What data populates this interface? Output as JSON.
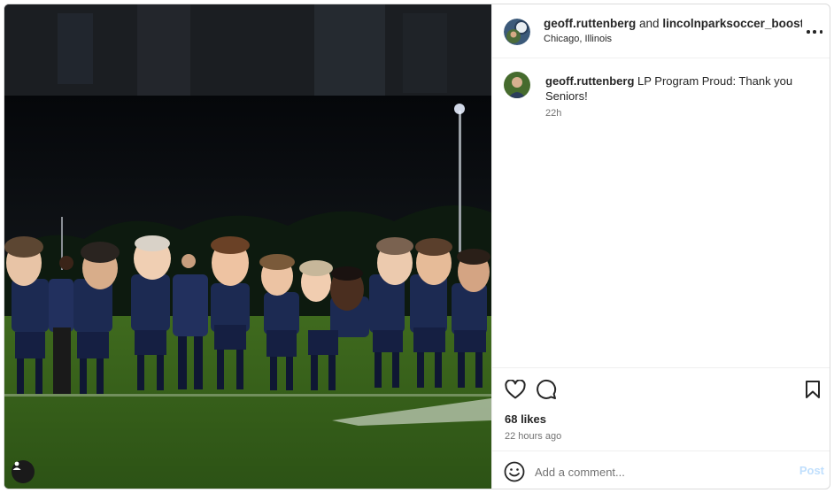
{
  "post": {
    "header": {
      "author": "geoff.ruttenberg",
      "conjunction": "and",
      "collaborator": "lincolnparksoccer_booste",
      "location": "Chicago, Illinois"
    },
    "caption": {
      "username": "geoff.ruttenberg",
      "text": "LP Program Proud: Thank you Seniors!",
      "time": "22h"
    },
    "likes": "68 likes",
    "posted_ago": "22 hours ago",
    "comment": {
      "placeholder": "Add a comment...",
      "post_label": "Post"
    },
    "icons": {
      "more": "more-options-icon",
      "like": "heart-icon",
      "comment": "comment-bubble-icon",
      "save": "bookmark-icon",
      "emoji": "emoji-icon",
      "tagged_user": "user-tag-icon"
    }
  }
}
